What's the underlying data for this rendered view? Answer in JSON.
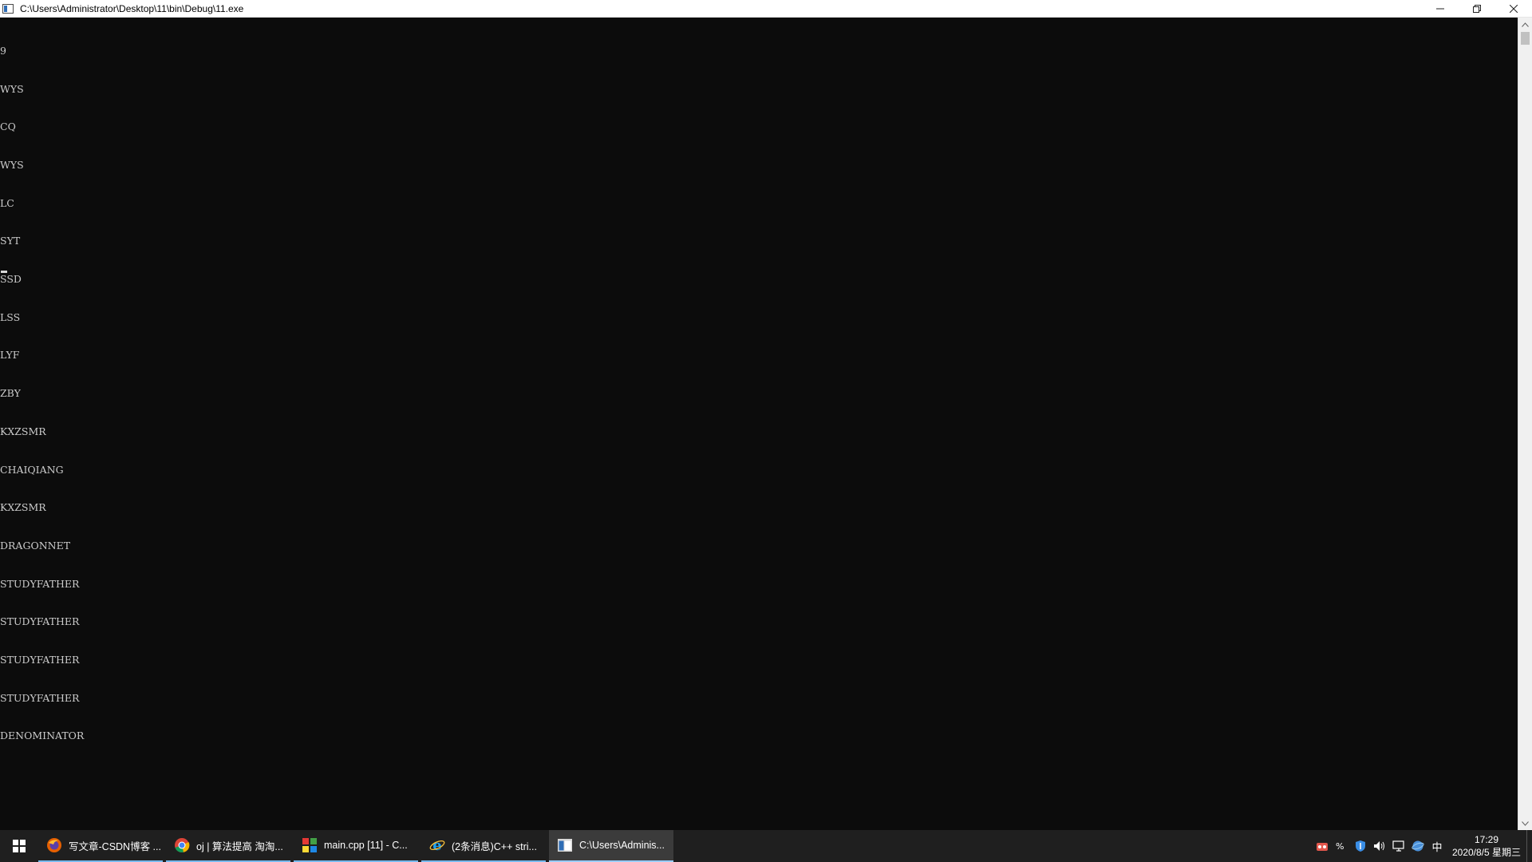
{
  "window": {
    "title": "C:\\Users\\Administrator\\Desktop\\11\\bin\\Debug\\11.exe"
  },
  "console": {
    "lines": [
      "9",
      "WYS",
      "CQ",
      "WYS",
      "LC",
      "SYT",
      "SSD",
      "LSS",
      "LYF",
      "ZBY",
      "KXZSMR",
      "CHAIQIANG",
      "KXZSMR",
      "DRAGONNET",
      "STUDYFATHER",
      "STUDYFATHER",
      "STUDYFATHER",
      "STUDYFATHER",
      "DENOMINATOR"
    ]
  },
  "taskbar": {
    "items": [
      {
        "label": "写文章-CSDN博客 ...",
        "icon": "firefox-icon"
      },
      {
        "label": "oj | 算法提高 淘淘...",
        "icon": "chrome-icon"
      },
      {
        "label": "main.cpp [11] - C...",
        "icon": "codeblocks-icon"
      },
      {
        "label": "(2条消息)C++ stri...",
        "icon": "ie-icon"
      },
      {
        "label": "C:\\Users\\Adminis...",
        "icon": "console-icon"
      }
    ],
    "tray": {
      "ime": "中",
      "time": "17:29",
      "date": "2020/8/5 星期三"
    }
  }
}
